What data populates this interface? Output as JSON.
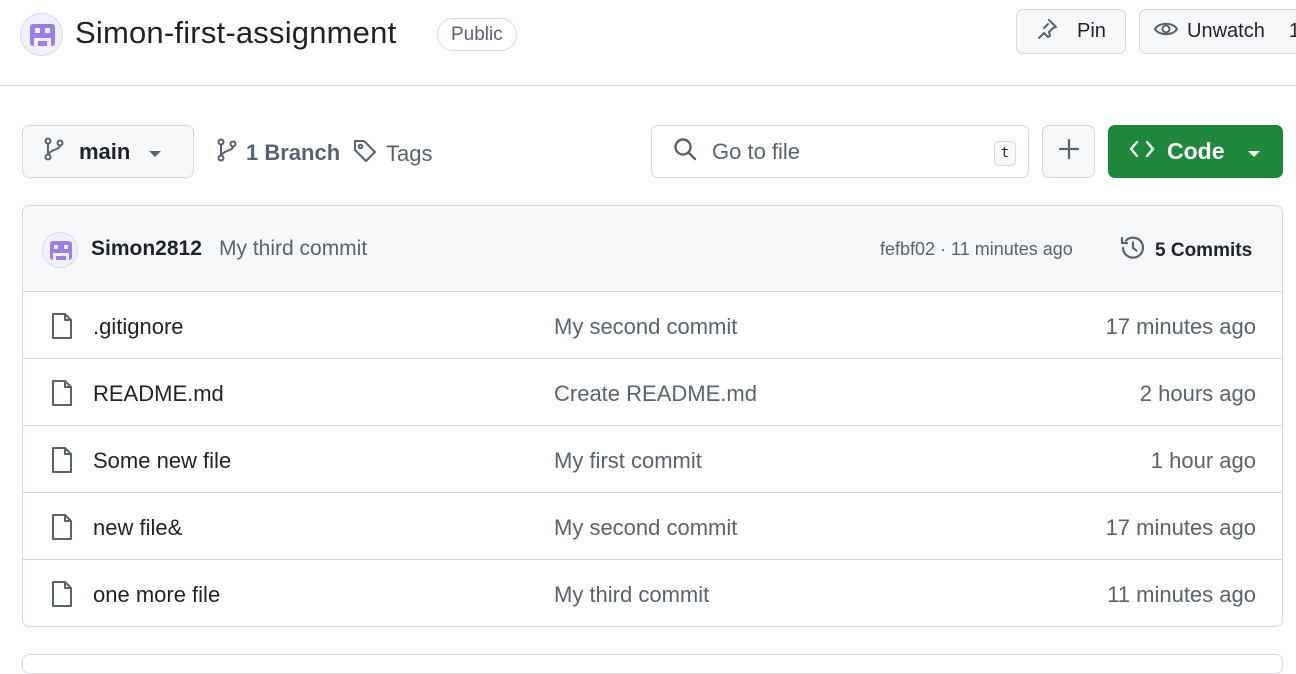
{
  "repo": {
    "name": "Simon-first-assignment",
    "visibility": "Public"
  },
  "header_actions": {
    "pin_label": "Pin",
    "watch_label": "Unwatch",
    "watch_count": "1"
  },
  "toolbar": {
    "branch": "main",
    "branch_count_label": "1 Branch",
    "tags_label": "Tags",
    "search_placeholder": "Go to file",
    "search_shortcut": "t",
    "code_label": "Code"
  },
  "latest_commit": {
    "author": "Simon2812",
    "message": "My third commit",
    "hash_time": "fefbf02 · 11 minutes ago",
    "commits_label": "5 Commits"
  },
  "files": [
    {
      "name": ".gitignore",
      "message": "My second commit",
      "time": "17 minutes ago"
    },
    {
      "name": "README.md",
      "message": "Create README.md",
      "time": "2 hours ago"
    },
    {
      "name": "Some new file",
      "message": "My first commit",
      "time": "1 hour ago"
    },
    {
      "name": "new file&",
      "message": "My second commit",
      "time": "17 minutes ago"
    },
    {
      "name": "one more file",
      "message": "My third commit",
      "time": "11 minutes ago"
    }
  ],
  "colors": {
    "accent_green": "#1f883d",
    "avatar_purple": "#9b7fe6",
    "muted_text": "#59636e",
    "border": "#d1d9e0"
  },
  "icons": [
    "avatar-icon",
    "pin-icon",
    "eye-icon",
    "git-branch-icon",
    "caret-down-icon",
    "tag-icon",
    "search-icon",
    "plus-icon",
    "code-icon",
    "history-icon",
    "file-icon"
  ]
}
